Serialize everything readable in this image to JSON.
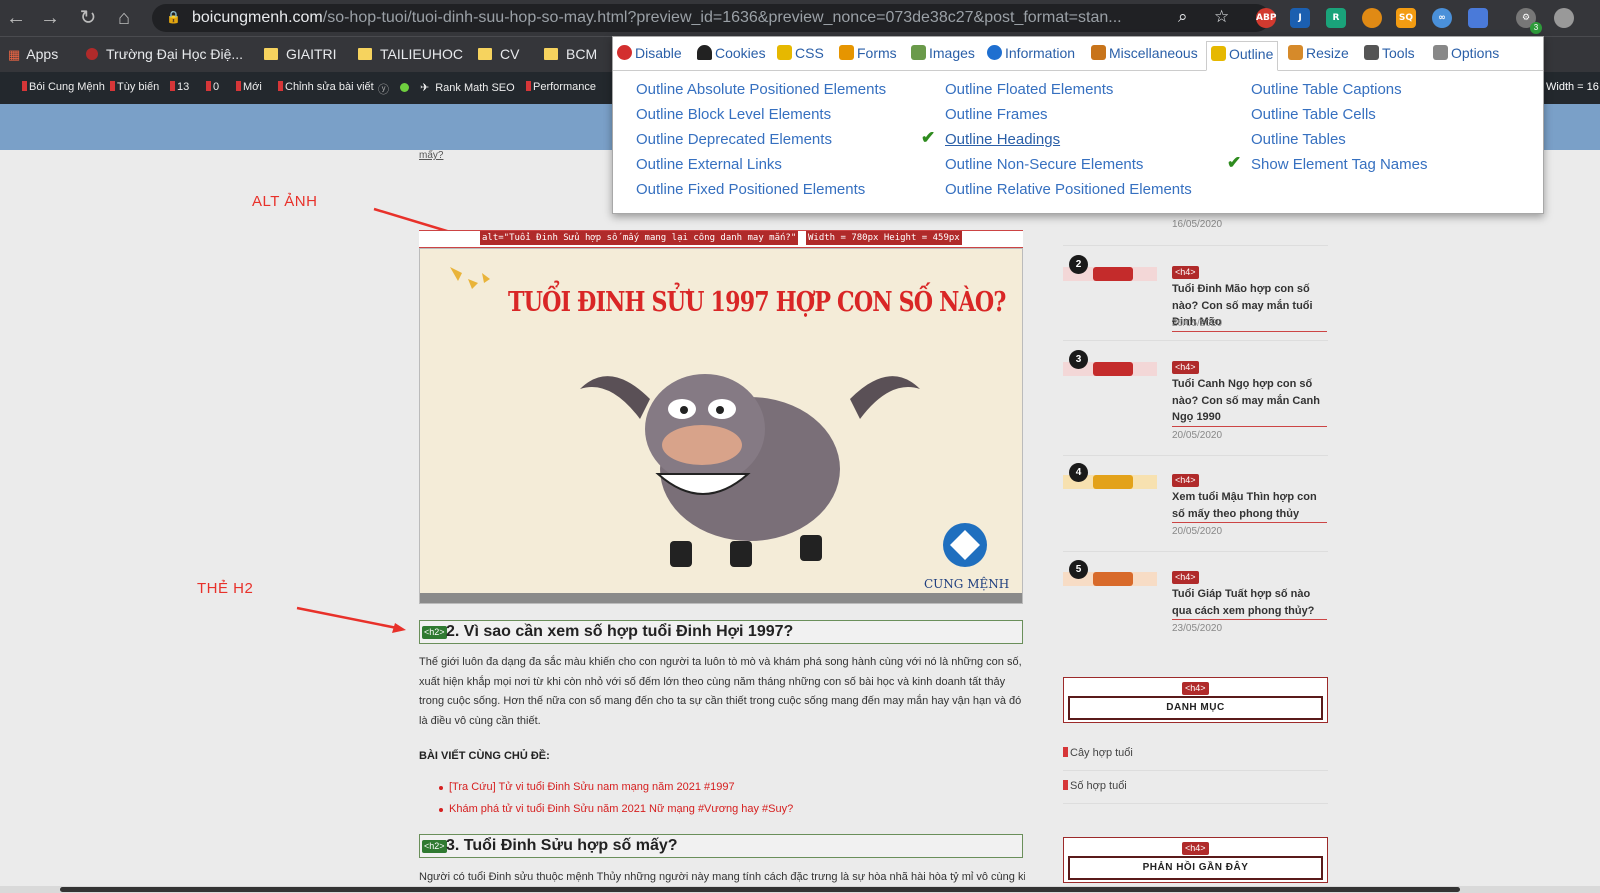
{
  "browser": {
    "url_domain": "boicungmenh.com",
    "url_path": "/so-hop-tuoi/tuoi-dinh-suu-hop-so-may.html?preview_id=1636&preview_nonce=073de38c27&post_format=stan...",
    "ext_badge": "3",
    "ext_labels": [
      "ABP",
      "SQ"
    ]
  },
  "bookmarks": [
    "Apps",
    "Trường Đại Học Điệ...",
    "GIAITRI",
    "TAILIEUHOC",
    "CV",
    "BCM"
  ],
  "adminbar": [
    "Bói Cung Mệnh",
    "Tùy biến",
    "13",
    "0",
    "Mới",
    "Chỉnh sửa bài viết",
    "Rank Math SEO",
    "Performance"
  ],
  "adminbar_right": "Width = 16",
  "popup": {
    "tabs": [
      "Disable",
      "Cookies",
      "CSS",
      "Forms",
      "Images",
      "Information",
      "Miscellaneous",
      "Outline",
      "Resize",
      "Tools",
      "Options"
    ],
    "col1": [
      "Outline Absolute Positioned Elements",
      "Outline Block Level Elements",
      "Outline Deprecated Elements",
      "Outline External Links",
      "Outline Fixed Positioned Elements"
    ],
    "col2": [
      "Outline Floated Elements",
      "Outline Frames",
      "Outline Headings",
      "Outline Non-Secure Elements",
      "Outline Relative Positioned Elements"
    ],
    "col3": [
      "Outline Table Captions",
      "Outline Table Cells",
      "Outline Tables",
      "Show Element Tag Names"
    ]
  },
  "annotations": {
    "alt": "ALT ẢNH",
    "h2": "THẺ H2"
  },
  "page": {
    "top_fragment": "mấy?",
    "alt_text": "alt=\"Tuổi Đinh Sửu hợp số mấy mang lại công danh may mắn?\"",
    "img_size": "Width = 780px Height = 459px",
    "img_title": "TUỔI ĐINH SỬU 1997 HỢP CON SỐ NÀO?",
    "img_logo": "CUNG MỆNH",
    "h2_tag": "<h2>",
    "h2_1": "2. Vì sao cần xem số hợp tuổi Đinh Hợi 1997?",
    "para1": "Thế giới luôn đa dạng đa sắc màu khiến cho con người ta luôn tò mò và khám phá song hành cùng với nó là những con số, xuất hiện khắp mọi nơi từ khi còn nhỏ với số đếm lớn theo cùng năm tháng những con số bài học và kinh doanh tất thảy trong cuộc sống. Hơn thế nữa con số mang đến cho ta sự cần thiết trong cuộc sống mang đến may mắn hay vận hạn và đó là điều vô cùng cần thiết.",
    "related_label": "BÀI VIẾT CÙNG CHỦ ĐỀ:",
    "related": [
      "[Tra Cứu] Tử vi tuổi Đinh Sửu nam mạng năm 2021 #1997",
      "Khám phá tử vi tuổi Đinh Sửu năm 2021 Nữ mạng #Vương hay #Suy?"
    ],
    "h2_2": "3. Tuổi Đinh Sửu hợp số mấy?",
    "para2": "Người có tuổi Đinh sửu thuộc mệnh Thủy những người này mang tính cách đặc trưng là sự hòa nhã hài hòa tỷ mỉ vô cùng kiên"
  },
  "sidebar": {
    "first_date": "16/05/2020",
    "h4": "<h4>",
    "items": [
      {
        "num": "2",
        "title": "Tuổi Đinh Mão hợp con số nào? Con số may mắn tuổi Đinh Mão",
        "date": "20/05/2020"
      },
      {
        "num": "3",
        "title": "Tuổi Canh Ngọ hợp con số nào? Con số may mắn Canh Ngọ 1990",
        "date": "20/05/2020"
      },
      {
        "num": "4",
        "title": "Xem tuổi Mậu Thìn hợp con số mấy theo phong thủy",
        "date": "20/05/2020"
      },
      {
        "num": "5",
        "title": "Tuổi Giáp Tuất hợp số nào qua cách xem phong thủy?",
        "date": "23/05/2020"
      }
    ],
    "widget1": "DANH MỤC",
    "categories": [
      "Cây hợp tuổi",
      "Số hợp tuổi"
    ],
    "widget2": "PHẢN HỒI GẦN ĐÂY"
  }
}
